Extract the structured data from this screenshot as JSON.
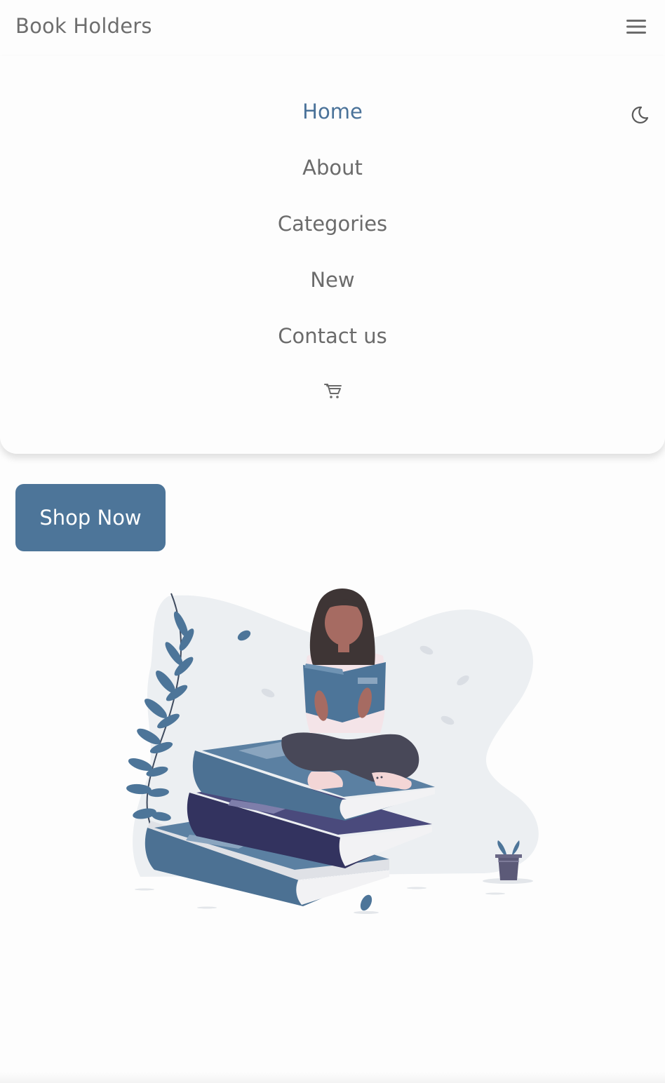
{
  "header": {
    "logo": "Book Holders",
    "menu_icon": "hamburger-menu-icon"
  },
  "nav": {
    "items": [
      {
        "label": "Home",
        "active": true
      },
      {
        "label": "About",
        "active": false
      },
      {
        "label": "Categories",
        "active": false
      },
      {
        "label": "New",
        "active": false
      },
      {
        "label": "Contact us",
        "active": false
      }
    ],
    "cart_icon": "cart-icon",
    "theme_icon": "moon-icon"
  },
  "hero": {
    "cta_label": "Shop Now",
    "illustration": "woman-reading-on-books-illustration"
  },
  "colors": {
    "accent": "#4d7599",
    "active_link": "#4a7299",
    "text": "#6b6b6b",
    "background": "#fdfdfd"
  }
}
